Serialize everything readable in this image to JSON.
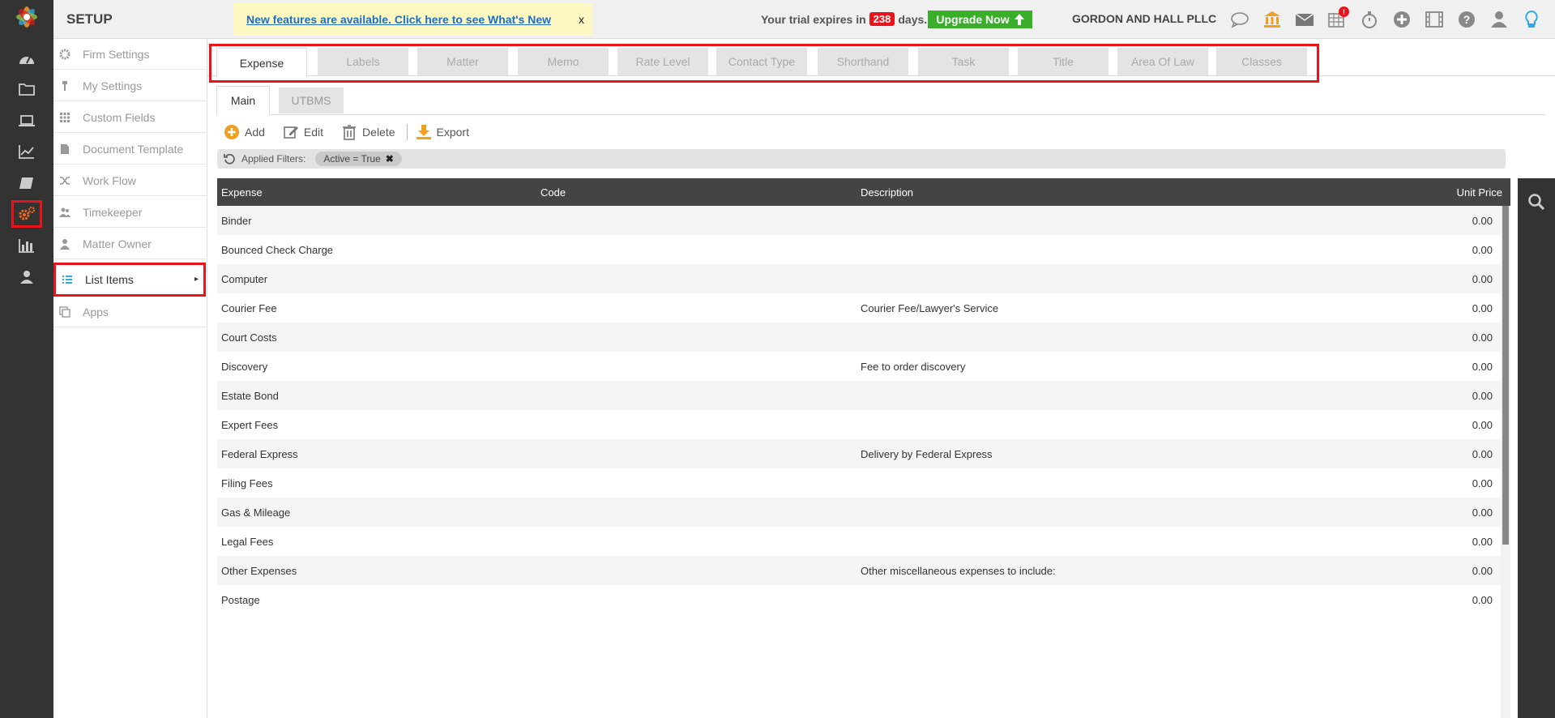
{
  "header": {
    "section_title": "SETUP",
    "notice_link": "New features are available. Click here to see What's New",
    "notice_close": "x",
    "trial_prefix": "Your trial expires in",
    "trial_days": "238",
    "trial_suffix": "days.",
    "upgrade_label": "Upgrade Now",
    "firm_name": "GORDON AND HALL PLLC",
    "notification_badge": "!"
  },
  "rail_icons": [
    "dashboard-icon",
    "folder-icon",
    "laptop-icon",
    "chart-line-icon",
    "book-icon",
    "settings-cogs-icon",
    "bar-chart-icon",
    "user-icon"
  ],
  "top_icons": [
    "chat-icon",
    "bank-icon",
    "mail-icon",
    "calendar-icon",
    "stopwatch-icon",
    "plus-circle-icon",
    "film-icon",
    "help-icon",
    "user-icon",
    "lightbulb-icon"
  ],
  "sidebar": {
    "items": [
      {
        "label": "Firm Settings",
        "icon": "gear-icon"
      },
      {
        "label": "My Settings",
        "icon": "wrench-icon"
      },
      {
        "label": "Custom Fields",
        "icon": "grid-icon"
      },
      {
        "label": "Document Template",
        "icon": "document-icon"
      },
      {
        "label": "Work Flow",
        "icon": "shuffle-icon"
      },
      {
        "label": "Timekeeper",
        "icon": "users-icon"
      },
      {
        "label": "Matter Owner",
        "icon": "user-icon"
      },
      {
        "label": "List Items",
        "icon": "list-icon"
      },
      {
        "label": "Apps",
        "icon": "copy-icon"
      }
    ]
  },
  "tabs": [
    "Expense",
    "Labels",
    "Matter",
    "Memo",
    "Rate Level",
    "Contact Type",
    "Shorthand",
    "Task",
    "Title",
    "Area Of Law",
    "Classes"
  ],
  "subtabs": {
    "main": "Main",
    "utbms": "UTBMS"
  },
  "toolbar": {
    "add": "Add",
    "edit": "Edit",
    "delete": "Delete",
    "export": "Export"
  },
  "filters": {
    "label": "Applied Filters:",
    "chip": "Active = True"
  },
  "grid": {
    "columns": [
      "Expense",
      "Code",
      "Description",
      "Unit Price"
    ],
    "rows": [
      [
        "Binder",
        "",
        "",
        "0.00"
      ],
      [
        "Bounced Check Charge",
        "",
        "",
        "0.00"
      ],
      [
        "Computer",
        "",
        "",
        "0.00"
      ],
      [
        "Courier Fee",
        "",
        "Courier Fee/Lawyer's Service",
        "0.00"
      ],
      [
        "Court Costs",
        "",
        "",
        "0.00"
      ],
      [
        "Discovery",
        "",
        "Fee to order discovery",
        "0.00"
      ],
      [
        "Estate Bond",
        "",
        "",
        "0.00"
      ],
      [
        "Expert Fees",
        "",
        "",
        "0.00"
      ],
      [
        "Federal Express",
        "",
        "Delivery by Federal Express",
        "0.00"
      ],
      [
        "Filing Fees",
        "",
        "",
        "0.00"
      ],
      [
        "Gas & Mileage",
        "",
        "",
        "0.00"
      ],
      [
        "Legal Fees",
        "",
        "",
        "0.00"
      ],
      [
        "Other Expenses",
        "",
        "Other miscellaneous expenses to include:",
        "0.00"
      ],
      [
        "Postage",
        "",
        "",
        "0.00"
      ]
    ]
  },
  "colors": {
    "accent_red": "#e8141b",
    "upgrade_green": "#3aae2a",
    "link_blue": "#1e6fc5",
    "rail_dark": "#333333",
    "orange": "#f0a01e"
  }
}
